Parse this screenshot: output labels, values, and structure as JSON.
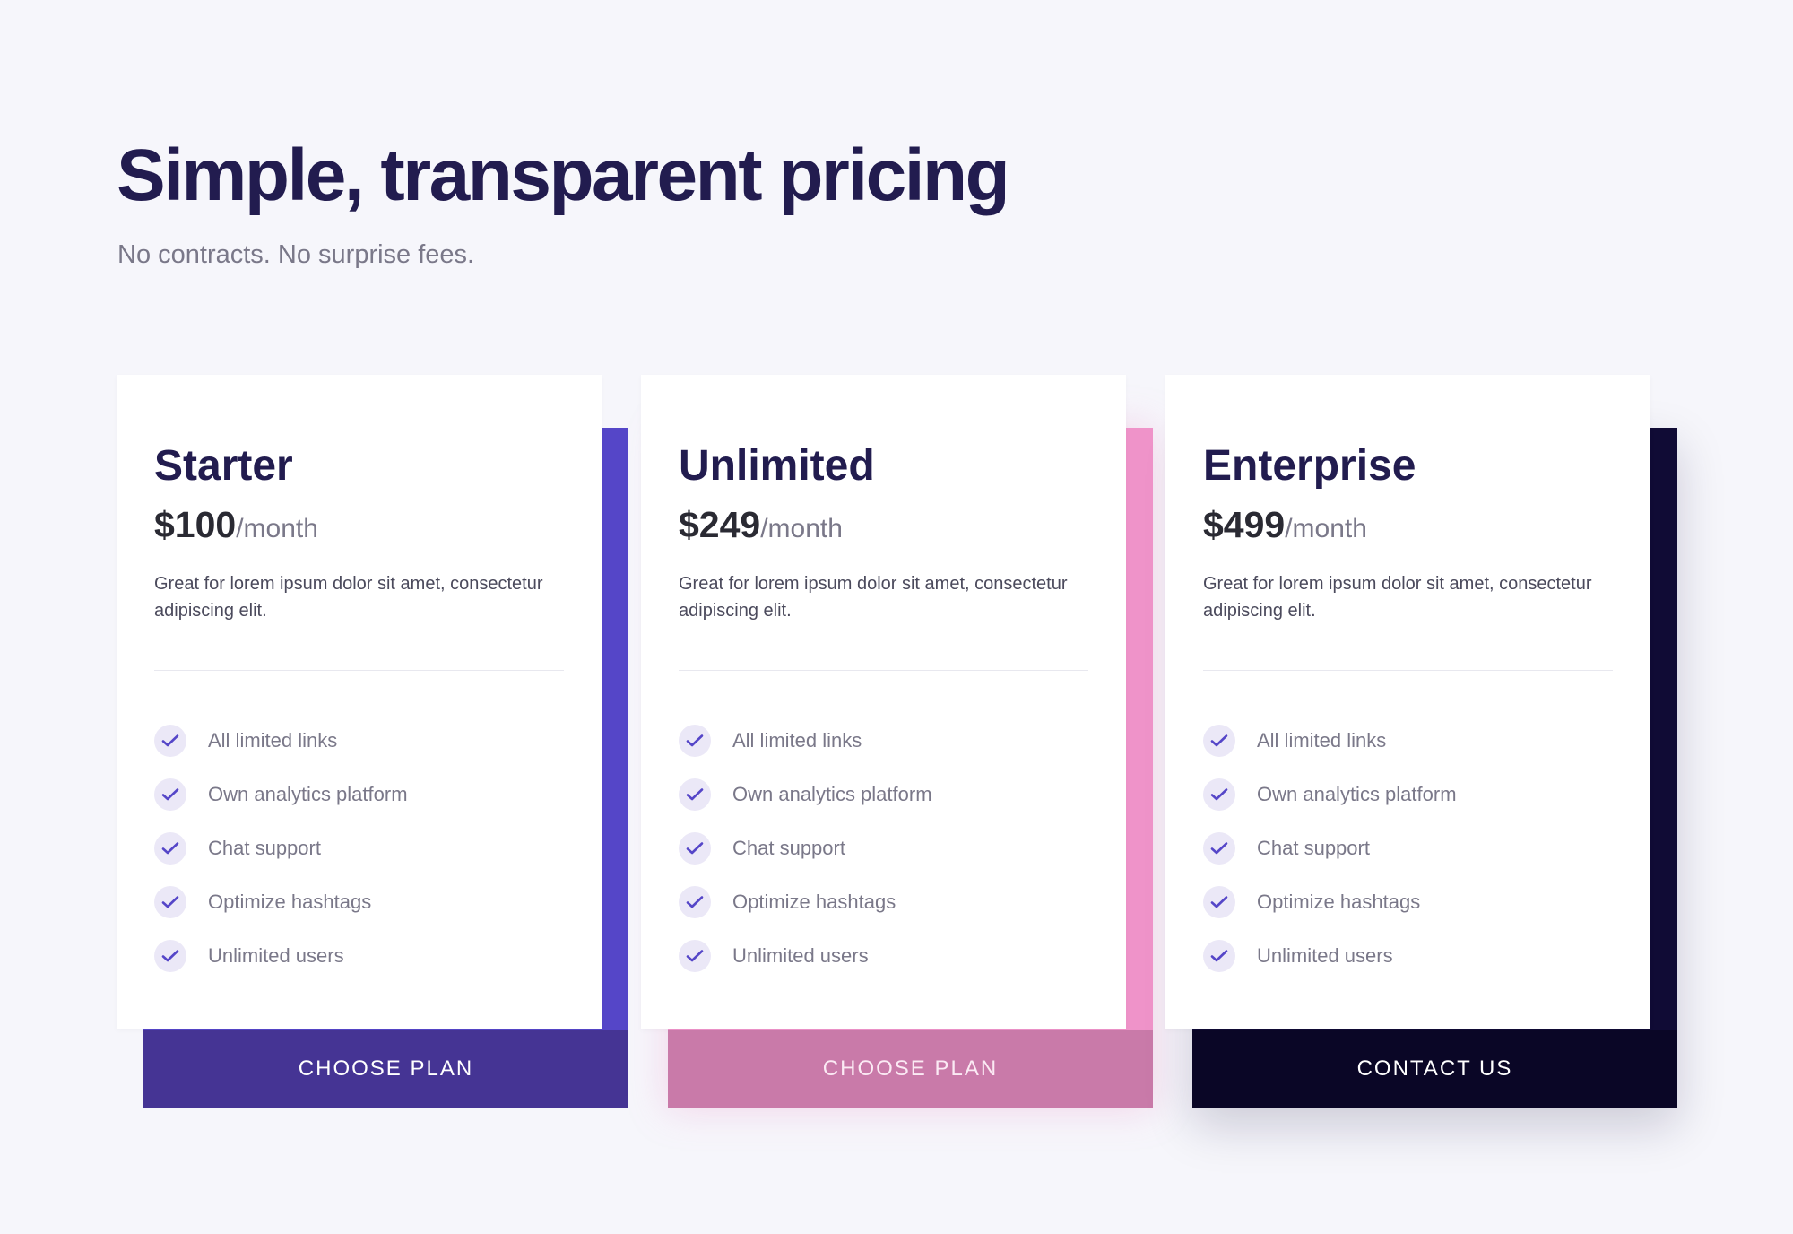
{
  "header": {
    "title": "Simple, transparent pricing",
    "subtitle": "No contracts. No surprise fees."
  },
  "colors": {
    "background": "#f6f6fb",
    "heading": "#221c4f",
    "muted_text": "#7a7889",
    "check_background": "#ebe8f7",
    "check_mark": "#5546c8"
  },
  "plans": [
    {
      "name": "Starter",
      "price": "$100",
      "period": "/month",
      "description": "Great for lorem ipsum dolor sit amet, consectetur adipiscing elit.",
      "features": [
        "All limited links",
        "Own analytics platform",
        "Chat support",
        "Optimize hashtags",
        "Unlimited users"
      ],
      "button_label": "CHOOSE PLAN",
      "accent_color": "#5546c8",
      "button_color": "#453494"
    },
    {
      "name": "Unlimited",
      "price": "$249",
      "period": "/month",
      "description": "Great for lorem ipsum dolor sit amet, consectetur adipiscing elit.",
      "features": [
        "All limited links",
        "Own analytics platform",
        "Chat support",
        "Optimize hashtags",
        "Unlimited users"
      ],
      "button_label": "CHOOSE PLAN",
      "accent_color": "#ef93c9",
      "button_color": "#c97aa9"
    },
    {
      "name": "Enterprise",
      "price": "$499",
      "period": "/month",
      "description": "Great for lorem ipsum dolor sit amet, consectetur adipiscing elit.",
      "features": [
        "All limited links",
        "Own analytics platform",
        "Chat support",
        "Optimize hashtags",
        "Unlimited users"
      ],
      "button_label": "CONTACT US",
      "accent_color": "#100b35",
      "button_color": "#0a0626"
    }
  ],
  "icons": {
    "feature_check": "check-icon"
  }
}
